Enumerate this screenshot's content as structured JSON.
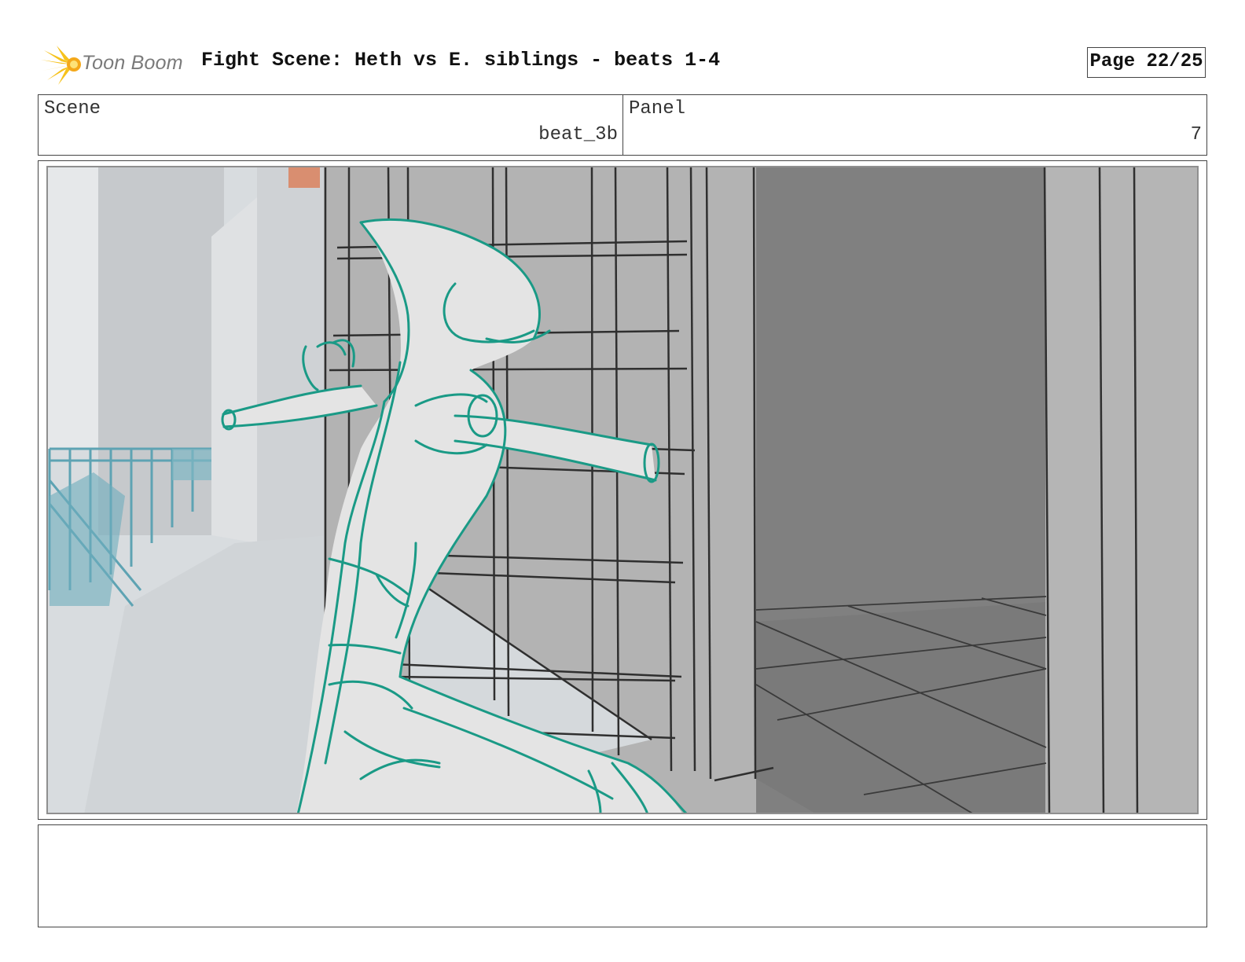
{
  "header": {
    "logo_text": "Toon Boom",
    "title": "Fight Scene: Heth vs E. siblings - beats 1-4",
    "page": "Page 22/25"
  },
  "info": {
    "scene_label": "Scene",
    "scene_value": "beat_3b",
    "panel_label": "Panel",
    "panel_value": "7"
  },
  "colors": {
    "sketch_line": "#1a9a86",
    "background_light": "#d6dadd",
    "wall_gray": "#b0b0b0",
    "doorway_dark": "#7f7f7f",
    "railing_teal": "#5ea3b3"
  },
  "icons": {
    "logo": "toon-boom-starburst-icon"
  },
  "notes": {
    "text": ""
  }
}
